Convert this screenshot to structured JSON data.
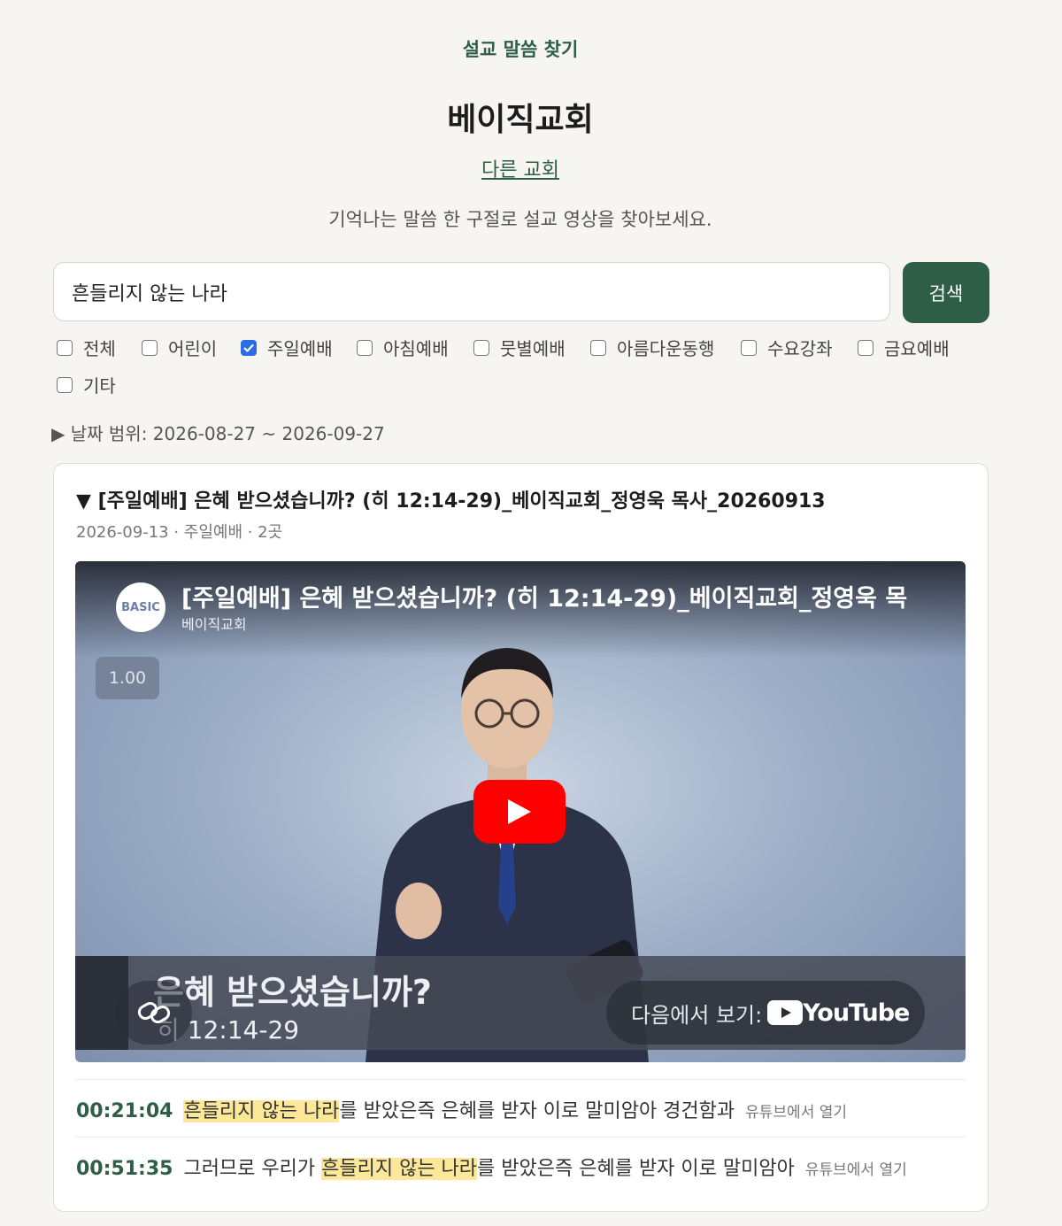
{
  "header": {
    "top_link": "설교 말씀 찾기",
    "church_name": "베이직교회",
    "other_church_link": "다른 교회",
    "subtitle": "기억나는 말씀 한 구절로 설교 영상을 찾아보세요."
  },
  "search": {
    "query": "흔들리지 않는 나라",
    "button_label": "검색"
  },
  "filters": [
    {
      "label": "전체",
      "checked": false
    },
    {
      "label": "어린이",
      "checked": false
    },
    {
      "label": "주일예배",
      "checked": true
    },
    {
      "label": "아침예배",
      "checked": false
    },
    {
      "label": "뭇별예배",
      "checked": false
    },
    {
      "label": "아름다운동행",
      "checked": false
    },
    {
      "label": "수요강좌",
      "checked": false
    },
    {
      "label": "금요예배",
      "checked": false
    },
    {
      "label": "기타",
      "checked": false
    }
  ],
  "date_range": "▶ 날짜 범위: 2026-08-27 ~ 2026-09-27",
  "result_card": {
    "title": "▼ [주일예배] 은혜 받으셨습니까? (히 12:14-29)_베이직교회_정영욱 목사_20260913",
    "meta": "2026-09-13 · 주일예배 · 2곳",
    "player": {
      "title": "[주일예배] 은혜 받으셨습니까? (히 12:14-29)_베이직교회_정영욱 목",
      "channel": "베이직교회",
      "channel_logo_text": "BASIC",
      "speed": "1.00",
      "lower_title": "은혜 받으셨습니까?",
      "lower_ref": "히 12:14-29",
      "watch_on": "다음에서 보기:",
      "youtube_word": "YouTube",
      "play_color": "#ff0000"
    },
    "matches": [
      {
        "time": "00:21:04",
        "before": "",
        "highlight": "흔들리지 않는 나라",
        "after": "를 받았은즉 은혜를 받자 이로 말미암아 경건함과",
        "link": "유튜브에서 열기"
      },
      {
        "time": "00:51:35",
        "before": "그러므로 우리가 ",
        "highlight": "흔들리지 않는 나라",
        "after": "를 받았은즉 은혜를 받자 이로 말미암아",
        "link": "유튜브에서 열기"
      }
    ]
  },
  "colors": {
    "accent": "#2f5e47",
    "highlight": "#fde89a",
    "checkbox": "#2b6de3"
  }
}
